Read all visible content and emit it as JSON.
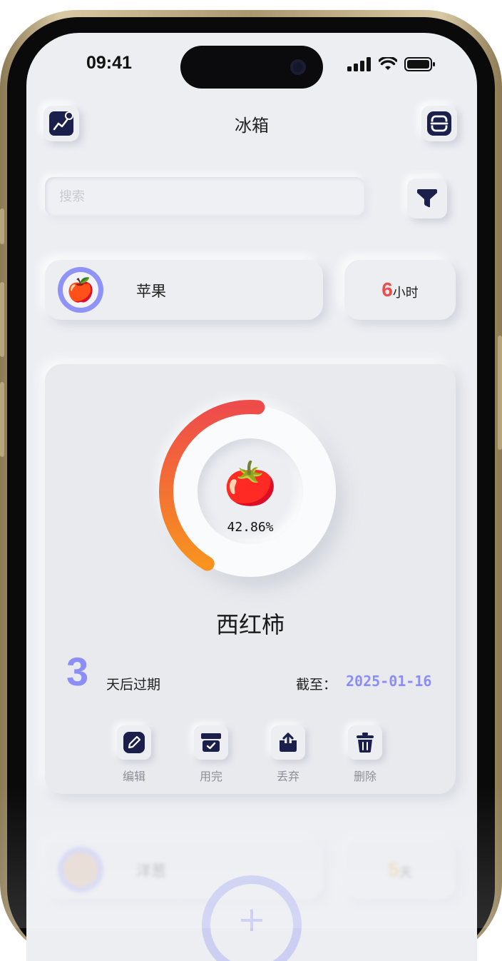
{
  "status_bar": {
    "time": "09:41",
    "icons": [
      "signal-icon",
      "wifi-icon",
      "battery-icon"
    ]
  },
  "header": {
    "title": "冰箱",
    "left_icon": "chart-icon",
    "right_icon": "scan-icon"
  },
  "search": {
    "placeholder": "搜索",
    "value": "",
    "filter_icon": "filter-icon"
  },
  "top_item": {
    "emoji": "🍎",
    "name": "苹果",
    "time_value": "6",
    "time_unit": "小时"
  },
  "main_card": {
    "emoji": "🍅",
    "progress_percent": 42.86,
    "progress_label": "42.86%",
    "name": "西红柿",
    "days_value": "3",
    "days_label": "天后过期",
    "until_label": "截至：",
    "until_date": "2025-01-16",
    "actions": [
      {
        "label": "编辑",
        "icon": "edit-icon"
      },
      {
        "label": "用完",
        "icon": "archive-check-icon"
      },
      {
        "label": "丢弃",
        "icon": "share-upload-icon"
      },
      {
        "label": "删除",
        "icon": "trash-icon"
      }
    ]
  },
  "next_item": {
    "name": "洋葱",
    "time_value": "5",
    "time_unit": "天"
  },
  "colors": {
    "accent": "#8a8ef5",
    "danger": "#ee4b4b",
    "warning": "#f0a020",
    "ring_start": "#ee4b4b",
    "ring_end": "#f7931e",
    "icon_dark": "#1b1f4b"
  }
}
